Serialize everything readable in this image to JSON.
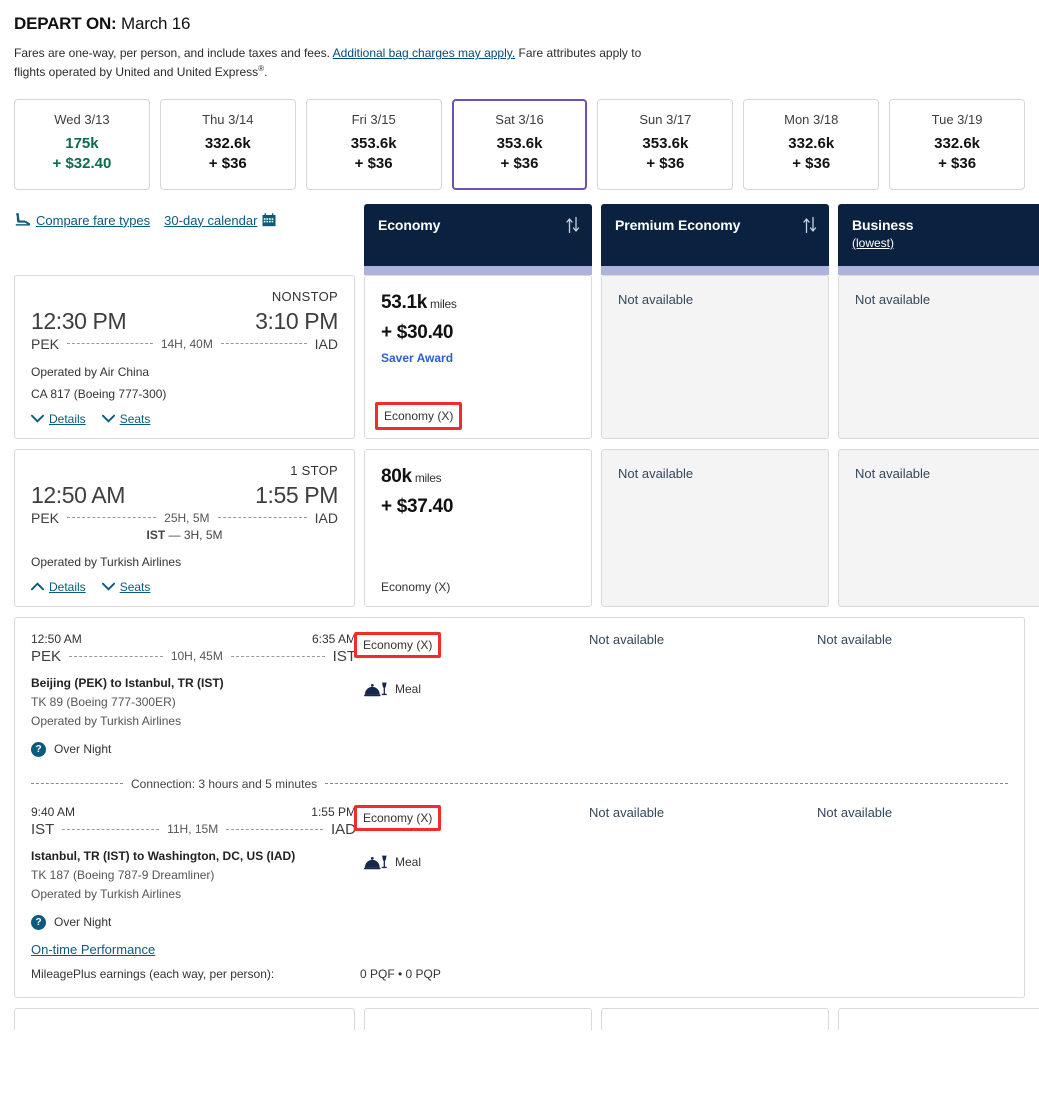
{
  "header": {
    "depart_label": "DEPART ON:",
    "depart_date": "March 16",
    "note_part1": "Fares are one-way, per person, and include taxes and fees.",
    "note_link": "Additional bag charges may apply.",
    "note_part2": "Fare attributes apply to flights operated by United and United Express",
    "note_sup": "®",
    "note_end": "."
  },
  "date_strip": [
    {
      "dow": "Wed 3/13",
      "miles": "175k",
      "cash": "+ $32.40",
      "lowest": true,
      "selected": false
    },
    {
      "dow": "Thu 3/14",
      "miles": "332.6k",
      "cash": "+ $36",
      "lowest": false,
      "selected": false
    },
    {
      "dow": "Fri 3/15",
      "miles": "353.6k",
      "cash": "+ $36",
      "lowest": false,
      "selected": false
    },
    {
      "dow": "Sat 3/16",
      "miles": "353.6k",
      "cash": "+ $36",
      "lowest": false,
      "selected": true
    },
    {
      "dow": "Sun 3/17",
      "miles": "353.6k",
      "cash": "+ $36",
      "lowest": false,
      "selected": false
    },
    {
      "dow": "Mon 3/18",
      "miles": "332.6k",
      "cash": "+ $36",
      "lowest": false,
      "selected": false
    },
    {
      "dow": "Tue 3/19",
      "miles": "332.6k",
      "cash": "+ $36",
      "lowest": false,
      "selected": false
    }
  ],
  "utility": {
    "compare_label": "Compare fare types",
    "calendar_label": "30-day calendar",
    "seat_icon": "seat-icon",
    "calendar_icon": "calendar-icon"
  },
  "cabins": [
    {
      "title": "Economy",
      "lowest": "",
      "sort_icon": "sort-icon"
    },
    {
      "title": "Premium Economy",
      "lowest": "",
      "sort_icon": "sort-icon"
    },
    {
      "title": "Business",
      "lowest": "(lowest)",
      "sort_icon": "sort-icon"
    }
  ],
  "flights": [
    {
      "stops": "NONSTOP",
      "depart_time": "12:30 PM",
      "arrive_time": "3:10 PM",
      "origin": "PEK",
      "destination": "IAD",
      "duration": "14H, 40M",
      "layover": "",
      "operated_by": "Operated by Air China",
      "flight_number": "CA 817 (Boeing 777-300)",
      "details_label": "Details",
      "seats_label": "Seats",
      "details_expanded": false,
      "fares": [
        {
          "miles": "53.1k",
          "miles_unit": "miles",
          "cash": "+ $30.40",
          "tag": "Saver Award",
          "class": "Economy (X)",
          "class_boxed": true,
          "available": true
        },
        {
          "na_text": "Not available",
          "available": false
        },
        {
          "na_text": "Not available",
          "available": false
        }
      ]
    },
    {
      "stops": "1 STOP",
      "depart_time": "12:50 AM",
      "arrive_time": "1:55 PM",
      "origin": "PEK",
      "destination": "IAD",
      "duration": "25H, 5M",
      "layover_code": "IST",
      "layover_dur": "— 3H, 5M",
      "operated_by": "Operated by Turkish Airlines",
      "flight_number": "",
      "details_label": "Details",
      "seats_label": "Seats",
      "details_expanded": true,
      "fares": [
        {
          "miles": "80k",
          "miles_unit": "miles",
          "cash": "+ $37.40",
          "tag": "",
          "class": "Economy (X)",
          "class_boxed": false,
          "available": true
        },
        {
          "na_text": "Not available",
          "available": false
        },
        {
          "na_text": "Not available",
          "available": false
        }
      ]
    }
  ],
  "detail_panel": {
    "legs": [
      {
        "depart_time": "12:50 AM",
        "arrive_time": "6:35 AM",
        "origin": "PEK",
        "destination": "IST",
        "duration": "10H, 45M",
        "city_pair": "Beijing (PEK) to Istanbul, TR (IST)",
        "equipment": "TK 89 (Boeing 777-300ER)",
        "operated_by": "Operated by Turkish Airlines",
        "cabin_class": "Economy (X)",
        "class_boxed": true,
        "meal_label": "Meal",
        "meal_icon": "meal-icon",
        "overnight_label": "Over Night",
        "overnight_icon": "help-circle-icon",
        "na_premium": "Not available",
        "na_business": "Not available"
      },
      {
        "depart_time": "9:40 AM",
        "arrive_time": "1:55 PM",
        "origin": "IST",
        "destination": "IAD",
        "duration": "11H, 15M",
        "city_pair": "Istanbul, TR (IST) to Washington, DC, US (IAD)",
        "equipment": "TK 187 (Boeing 787-9 Dreamliner)",
        "operated_by": "Operated by Turkish Airlines",
        "cabin_class": "Economy (X)",
        "class_boxed": true,
        "meal_label": "Meal",
        "meal_icon": "meal-icon",
        "overnight_label": "Over Night",
        "overnight_icon": "help-circle-icon",
        "na_premium": "Not available",
        "na_business": "Not available"
      }
    ],
    "connection_text": "Connection: 3 hours and 5 minutes",
    "otp_link": "On-time Performance",
    "mileage_label": "MileagePlus earnings (each way, per person):",
    "mileage_value": "0 PQF • 0 PQP"
  },
  "colors": {
    "navy": "#0a2240",
    "lavender": "#aeb3dd",
    "teal_link": "#0a5a7d",
    "green_low": "#0b6b4f",
    "purple_selected": "#6b4fbb",
    "red_highlight": "#f42b2b",
    "saver_blue": "#2b5fd9"
  }
}
